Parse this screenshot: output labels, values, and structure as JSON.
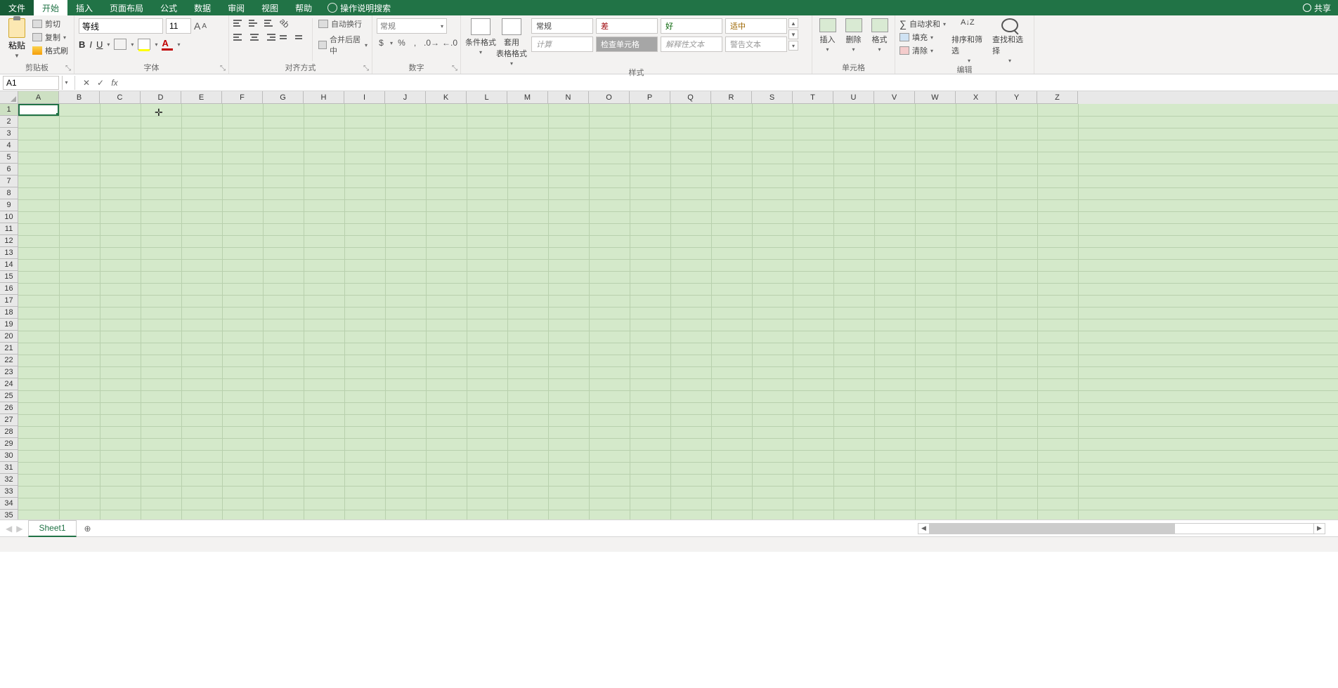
{
  "menu": {
    "file": "文件",
    "items": [
      "开始",
      "插入",
      "页面布局",
      "公式",
      "数据",
      "审阅",
      "视图",
      "帮助"
    ],
    "tell_me": "操作说明搜索",
    "share": "共享",
    "active_index": 0
  },
  "ribbon": {
    "clipboard": {
      "label": "剪贴板",
      "paste": "粘贴",
      "cut": "剪切",
      "copy": "复制",
      "paint": "格式刷"
    },
    "font": {
      "label": "字体",
      "name": "等线",
      "size": "11"
    },
    "alignment": {
      "label": "对齐方式",
      "wrap": "自动换行",
      "merge": "合并后居中"
    },
    "number": {
      "label": "数字",
      "format": "常规"
    },
    "styles": {
      "label": "样式",
      "cond": "条件格式",
      "table": "套用\n表格格式",
      "boxes": {
        "normal": "常规",
        "bad": "差",
        "good": "好",
        "neutral": "适中",
        "calc": "计算",
        "check": "检查单元格",
        "expl": "解释性文本",
        "warn": "警告文本"
      }
    },
    "cells": {
      "label": "单元格",
      "insert": "插入",
      "delete": "删除",
      "format": "格式"
    },
    "editing": {
      "label": "编辑",
      "autosum": "自动求和",
      "fill": "填充",
      "clear": "清除",
      "sort": "排序和筛选",
      "find": "查找和选择"
    }
  },
  "namebox": "A1",
  "columns": [
    "A",
    "B",
    "C",
    "D",
    "E",
    "F",
    "G",
    "H",
    "I",
    "J",
    "K",
    "L",
    "M",
    "N",
    "O",
    "P",
    "Q",
    "R",
    "S",
    "T",
    "U",
    "V",
    "W",
    "X",
    "Y",
    "Z"
  ],
  "row_count": 35,
  "active_col": "A",
  "active_row": 1,
  "tabs": {
    "sheet1": "Sheet1"
  },
  "cursor_col_index": 3
}
